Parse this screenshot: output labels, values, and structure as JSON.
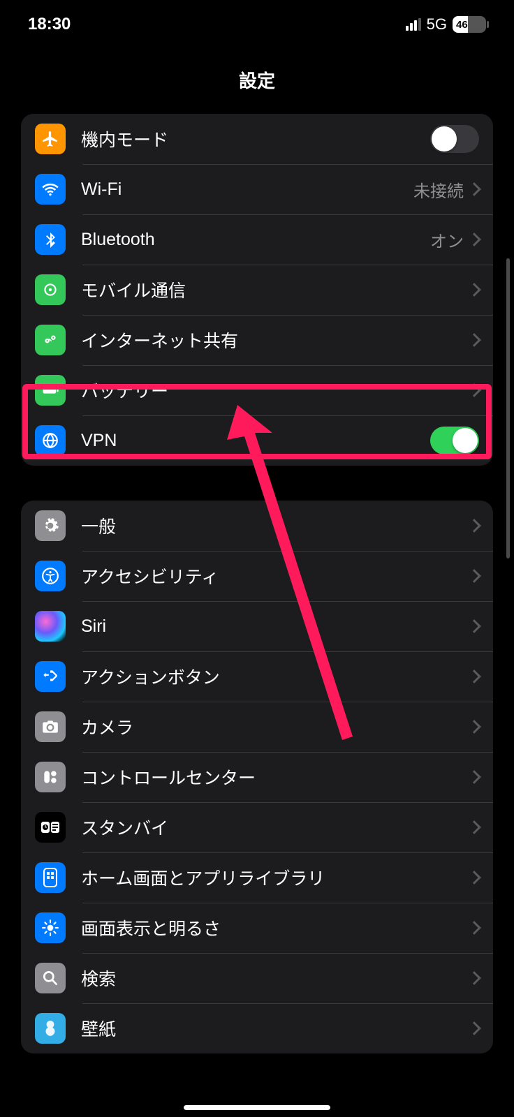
{
  "status": {
    "time": "18:30",
    "network": "5G",
    "battery_percent": "46"
  },
  "header": {
    "title": "設定"
  },
  "group1": [
    {
      "key": "airplane",
      "label": "機内モード",
      "control": "toggle_off",
      "icon": "airplane-icon"
    },
    {
      "key": "wifi",
      "label": "Wi-Fi",
      "value": "未接続",
      "control": "chevron",
      "icon": "wifi-icon"
    },
    {
      "key": "bluetooth",
      "label": "Bluetooth",
      "value": "オン",
      "control": "chevron",
      "icon": "bluetooth-icon"
    },
    {
      "key": "cellular",
      "label": "モバイル通信",
      "control": "chevron",
      "icon": "cellular-icon"
    },
    {
      "key": "hotspot",
      "label": "インターネット共有",
      "control": "chevron",
      "icon": "hotspot-icon"
    },
    {
      "key": "battery",
      "label": "バッテリー",
      "control": "chevron",
      "icon": "battery-icon"
    },
    {
      "key": "vpn",
      "label": "VPN",
      "control": "toggle_on",
      "icon": "vpn-icon"
    }
  ],
  "group2": [
    {
      "key": "general",
      "label": "一般",
      "control": "chevron",
      "icon": "gear-icon"
    },
    {
      "key": "accessibility",
      "label": "アクセシビリティ",
      "control": "chevron",
      "icon": "accessibility-icon"
    },
    {
      "key": "siri",
      "label": "Siri",
      "control": "chevron",
      "icon": "siri-icon"
    },
    {
      "key": "action",
      "label": "アクションボタン",
      "control": "chevron",
      "icon": "action-button-icon"
    },
    {
      "key": "camera",
      "label": "カメラ",
      "control": "chevron",
      "icon": "camera-icon"
    },
    {
      "key": "controlcenter",
      "label": "コントロールセンター",
      "control": "chevron",
      "icon": "control-center-icon"
    },
    {
      "key": "standby",
      "label": "スタンバイ",
      "control": "chevron",
      "icon": "standby-icon"
    },
    {
      "key": "homescreen",
      "label": "ホーム画面とアプリライブラリ",
      "control": "chevron",
      "icon": "home-screen-icon"
    },
    {
      "key": "display",
      "label": "画面表示と明るさ",
      "control": "chevron",
      "icon": "brightness-icon"
    },
    {
      "key": "search",
      "label": "検索",
      "control": "chevron",
      "icon": "search-icon"
    },
    {
      "key": "wallpaper",
      "label": "壁紙",
      "control": "chevron",
      "icon": "wallpaper-icon"
    }
  ]
}
